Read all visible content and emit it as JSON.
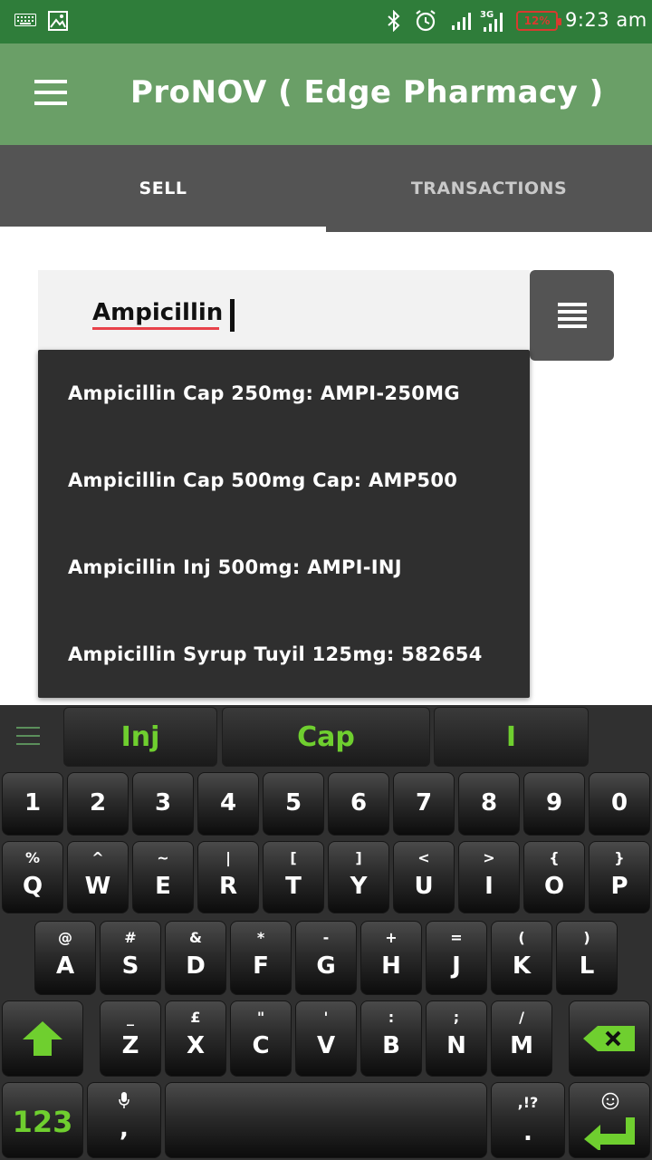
{
  "status_bar": {
    "time": "9:23 am",
    "battery": "12%",
    "network": "3G"
  },
  "app_bar": {
    "title": "ProNOV ( Edge Pharmacy )"
  },
  "tabs": [
    {
      "label": "SELL",
      "active": true
    },
    {
      "label": "TRANSACTIONS",
      "active": false
    }
  ],
  "search": {
    "value": "Ampicillin"
  },
  "suggestions": [
    "Ampicillin Cap 250mg: AMPI-250MG",
    "Ampicillin Cap 500mg Cap: AMP500",
    "Ampicillin Inj 500mg: AMPI-INJ",
    "Ampicillin Syrup Tuyil 125mg: 582654"
  ],
  "keyboard": {
    "word_suggestions": [
      "Inj",
      "Cap",
      "I"
    ],
    "number_row": [
      "1",
      "2",
      "3",
      "4",
      "5",
      "6",
      "7",
      "8",
      "9",
      "0"
    ],
    "row1": [
      {
        "main": "Q",
        "sub": "%"
      },
      {
        "main": "W",
        "sub": "^"
      },
      {
        "main": "E",
        "sub": "~"
      },
      {
        "main": "R",
        "sub": "|"
      },
      {
        "main": "T",
        "sub": "["
      },
      {
        "main": "Y",
        "sub": "]"
      },
      {
        "main": "U",
        "sub": "<"
      },
      {
        "main": "I",
        "sub": ">"
      },
      {
        "main": "O",
        "sub": "{"
      },
      {
        "main": "P",
        "sub": "}"
      }
    ],
    "row2": [
      {
        "main": "A",
        "sub": "@"
      },
      {
        "main": "S",
        "sub": "#"
      },
      {
        "main": "D",
        "sub": "&"
      },
      {
        "main": "F",
        "sub": "*"
      },
      {
        "main": "G",
        "sub": "-"
      },
      {
        "main": "H",
        "sub": "+"
      },
      {
        "main": "J",
        "sub": "="
      },
      {
        "main": "K",
        "sub": "("
      },
      {
        "main": "L",
        "sub": ")"
      }
    ],
    "row3": [
      {
        "main": "Z",
        "sub": "_"
      },
      {
        "main": "X",
        "sub": "£"
      },
      {
        "main": "C",
        "sub": "\""
      },
      {
        "main": "V",
        "sub": "'"
      },
      {
        "main": "B",
        "sub": ":"
      },
      {
        "main": "N",
        "sub": ";"
      },
      {
        "main": "M",
        "sub": "/"
      }
    ],
    "bottom": {
      "symbols_label": "123",
      "comma_main": ",",
      "period_main": ".",
      "period_sub": ",!?"
    }
  },
  "colors": {
    "status_bar": "#2f7d3a",
    "app_bar": "#6a9f67",
    "tabs": "#545454",
    "accent_green": "#6fcf2f",
    "dropdown": "#2f2f2f"
  }
}
